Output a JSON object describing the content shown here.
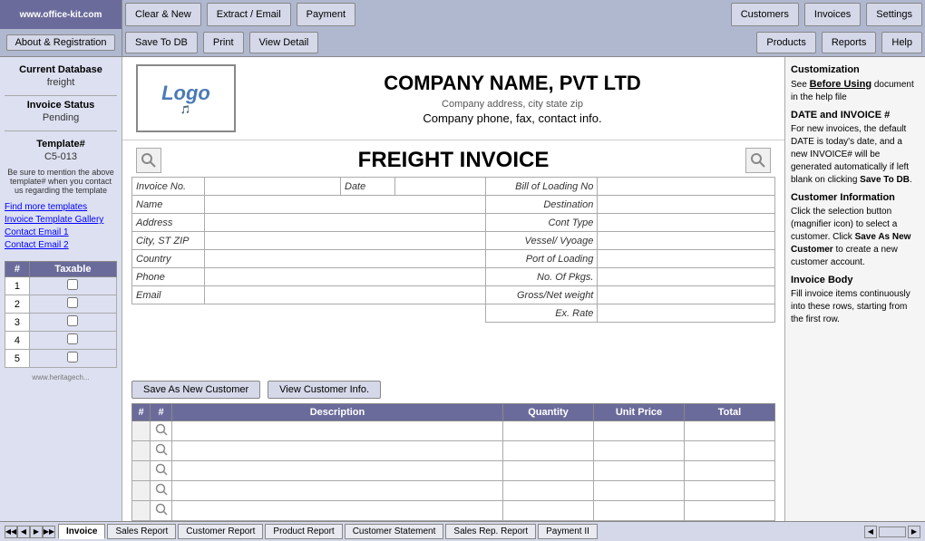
{
  "website": "www.office-kit.com",
  "toolbar": {
    "row1": {
      "clear_new": "Clear & New",
      "extract_email": "Extract / Email",
      "payment": "Payment",
      "customers": "Customers",
      "invoices": "Invoices",
      "settings": "Settings"
    },
    "row2": {
      "about": "About & Registration",
      "save_to_db": "Save To DB",
      "print": "Print",
      "view_detail": "View Detail",
      "products": "Products",
      "reports": "Reports",
      "help": "Help"
    }
  },
  "right_panel": {
    "title": "Customization",
    "highlight": "Before Using",
    "text1": "See Before Using document in the help file",
    "section1_title": "DATE and INVOICE #",
    "section1_text": "For new invoices, the default DATE is today's date, and a new INVOICE# will be generated automatically if left blank on clicking",
    "section1_highlight": "Save To DB",
    "section2_title": "Customer Information",
    "section2_text": "Click the selection button (magnifier icon) to select a customer. Click",
    "section2_highlight": "Save As New Customer",
    "section2_text2": "to create a new customer account.",
    "section3_title": "Invoice Body",
    "section3_text": "Fill invoice items continuously into these rows, starting from the first row."
  },
  "sidebar": {
    "current_db_label": "Current Database",
    "current_db_value": "freight",
    "invoice_status_label": "Invoice Status",
    "invoice_status_value": "Pending",
    "template_label": "Template#",
    "template_value": "C5-013",
    "template_note": "Be sure to mention the above template# when you contact us regarding the template",
    "links": [
      "Find more templates",
      "Invoice Template Gallery",
      "Contact Email 1",
      "Contact Email 2"
    ],
    "table": {
      "col1": "#",
      "col2": "Taxable",
      "rows": [
        {
          "num": "1"
        },
        {
          "num": "2"
        },
        {
          "num": "3"
        },
        {
          "num": "4"
        },
        {
          "num": "5"
        }
      ]
    }
  },
  "company": {
    "name": "COMPANY NAME,  PVT LTD",
    "address": "Company address, city state zip",
    "phone": "Company phone, fax, contact info."
  },
  "invoice": {
    "title": "FREIGHT INVOICE",
    "fields_left": [
      {
        "label": "Invoice No.",
        "span": true
      },
      {
        "label": "Name"
      },
      {
        "label": "Address"
      },
      {
        "label": "City, ST ZIP"
      },
      {
        "label": "Country"
      },
      {
        "label": "Phone"
      },
      {
        "label": "Email"
      }
    ],
    "fields_middle": [
      {
        "label": "Date"
      }
    ],
    "fields_right": [
      {
        "label": "Bill of Loading No"
      },
      {
        "label": "Destination"
      },
      {
        "label": "Cont Type"
      },
      {
        "label": "Vessel/ Vyoage"
      },
      {
        "label": "Port of Loading"
      },
      {
        "label": "No. Of Pkgs."
      },
      {
        "label": "Gross/Net weight"
      },
      {
        "label": "Ex. Rate"
      }
    ],
    "btn_save_customer": "Save As New Customer",
    "btn_view_customer": "View Customer Info.",
    "body_headers": [
      "#",
      "Description",
      "Quantity",
      "Unit Price",
      "Total"
    ],
    "rows": [
      {
        "num": ""
      },
      {
        "num": ""
      },
      {
        "num": ""
      },
      {
        "num": ""
      },
      {
        "num": ""
      }
    ]
  },
  "tabs": [
    {
      "label": "Invoice",
      "active": true
    },
    {
      "label": "Sales Report",
      "active": false
    },
    {
      "label": "Customer Report",
      "active": false
    },
    {
      "label": "Product Report",
      "active": false
    },
    {
      "label": "Customer Statement",
      "active": false
    },
    {
      "label": "Sales Rep. Report",
      "active": false
    },
    {
      "label": "Payment II",
      "active": false
    }
  ]
}
